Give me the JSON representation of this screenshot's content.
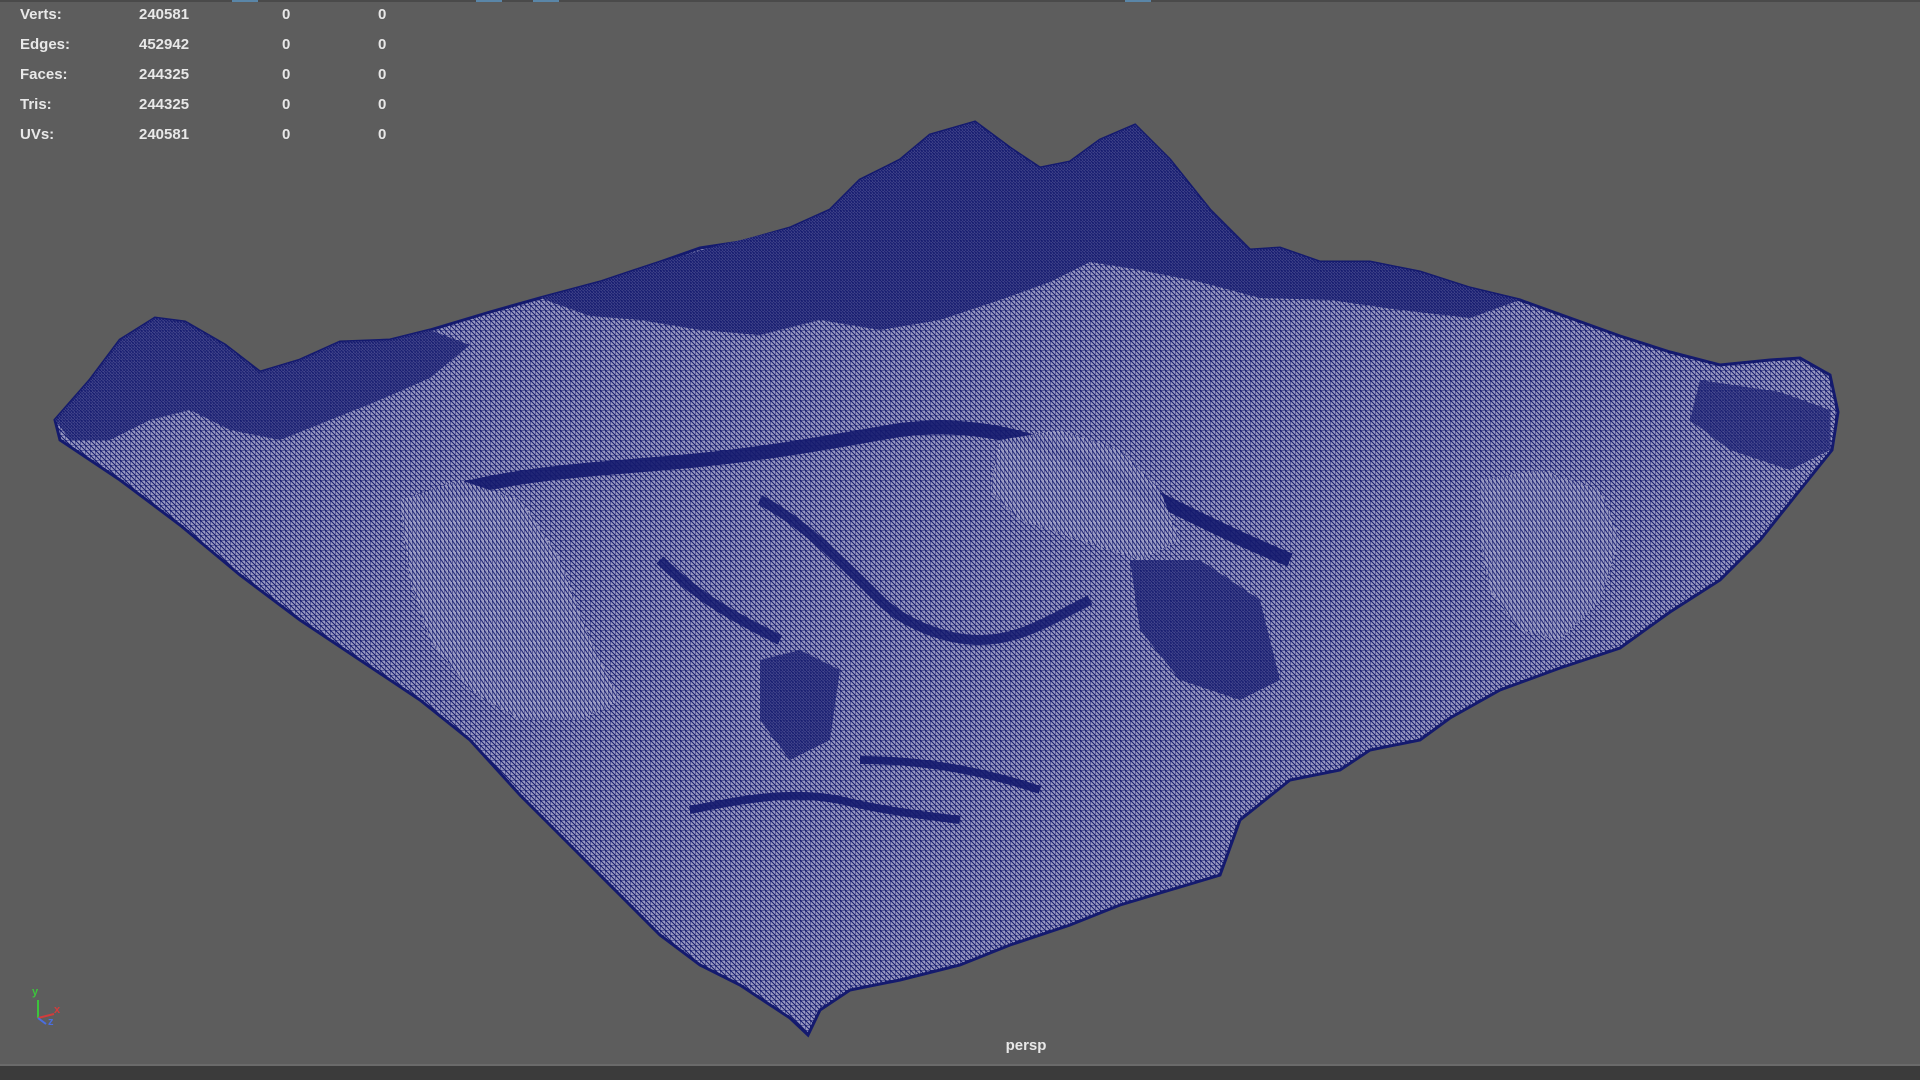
{
  "hud": {
    "rows": [
      {
        "label": "Verts:",
        "total": "240581",
        "selected": "0",
        "third": "0"
      },
      {
        "label": "Edges:",
        "total": "452942",
        "selected": "0",
        "third": "0"
      },
      {
        "label": "Faces:",
        "total": "244325",
        "selected": "0",
        "third": "0"
      },
      {
        "label": "Tris:",
        "total": "244325",
        "selected": "0",
        "third": "0"
      },
      {
        "label": "UVs:",
        "total": "240581",
        "selected": "0",
        "third": "0"
      }
    ]
  },
  "viewport": {
    "camera_name": "persp",
    "background_color": "#5d5d5d",
    "wireframe_color": "#141a6e",
    "mesh_face_color": "#8a8ab6",
    "object": "terrain-wireframe-mesh"
  },
  "axis_gizmo": {
    "x_label": "x",
    "y_label": "y",
    "z_label": "z",
    "x_color": "#d23c3c",
    "y_color": "#3cc43c",
    "z_color": "#4a6ee0"
  },
  "colors": {
    "top_tick": "#5a86a8",
    "bottom_bar": "#3b3b3b"
  }
}
